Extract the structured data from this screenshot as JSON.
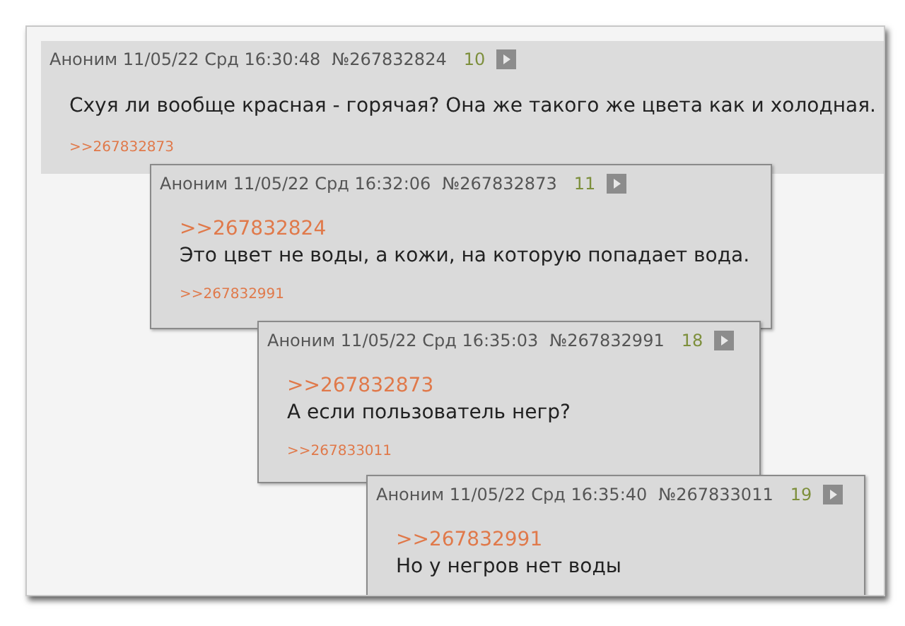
{
  "posts": [
    {
      "author": "Аноним",
      "date": "11/05/22 Срд 16:30:48",
      "number": "№267832824",
      "count": "10",
      "text": "Схуя ли вообще красная - горячая? Она же такого же цвета как и холодная.",
      "reply": ">>267832873"
    },
    {
      "author": "Аноним",
      "date": "11/05/22 Срд 16:32:06",
      "number": "№267832873",
      "count": "11",
      "quote": ">>267832824",
      "text": "Это цвет не воды, а кожи, на которую попадает вода.",
      "reply": ">>267832991"
    },
    {
      "author": "Аноним",
      "date": "11/05/22 Срд 16:35:03",
      "number": "№267832991",
      "count": "18",
      "quote": ">>267832873",
      "text": "А если пользователь негр?",
      "reply": ">>267833011"
    },
    {
      "author": "Аноним",
      "date": "11/05/22 Срд 16:35:40",
      "number": "№267833011",
      "count": "19",
      "quote": ">>267832991",
      "text": "Но у негров нет воды"
    }
  ]
}
